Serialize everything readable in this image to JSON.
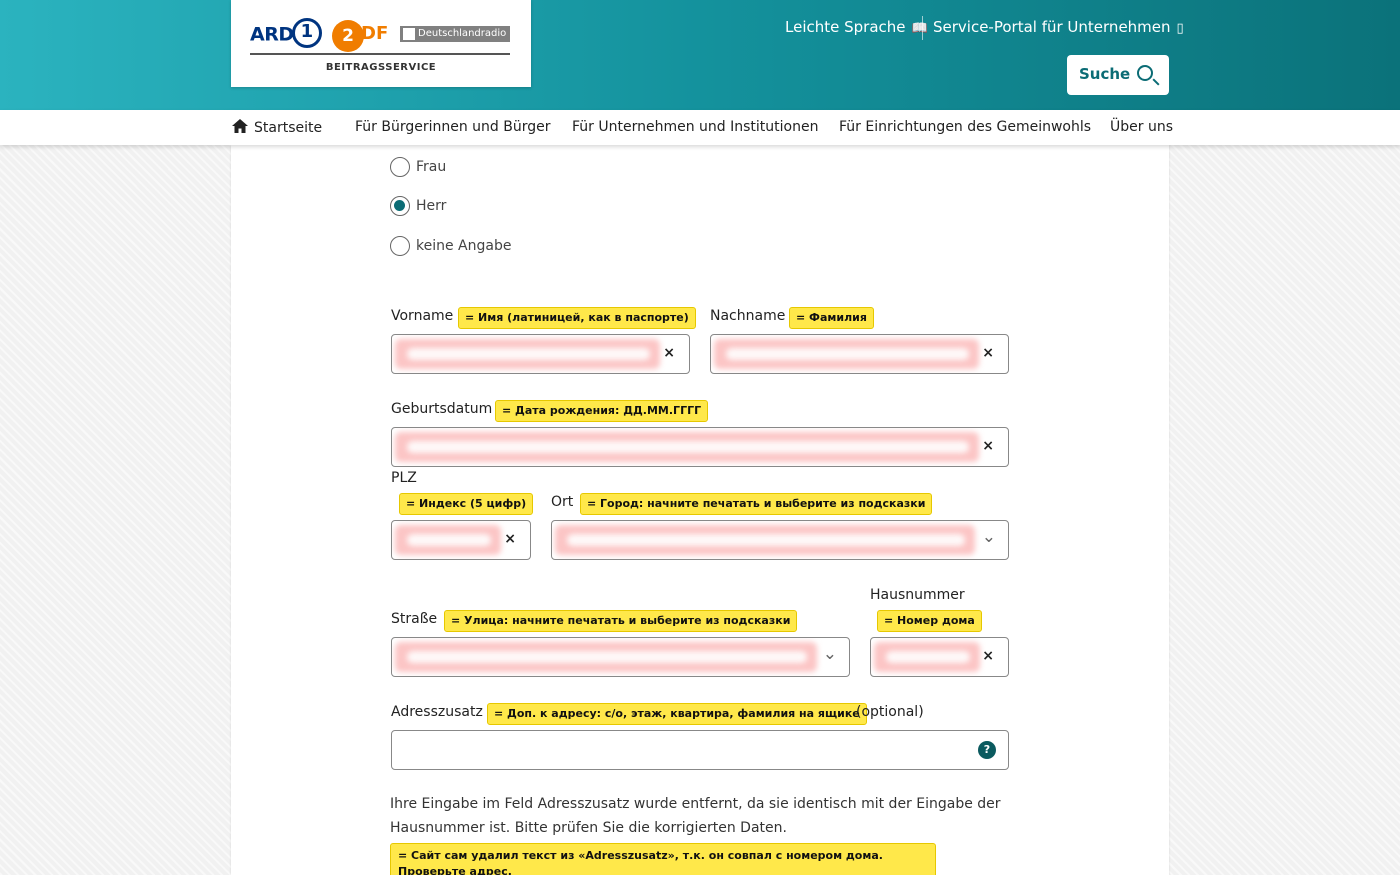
{
  "header": {
    "logos": {
      "ard": "ARD",
      "ard_one": "1",
      "zdf": "2",
      "zdf_rest": "DF",
      "dlr": "Deutschlandradio",
      "sub": "BEITRAGSSERVICE"
    },
    "links": {
      "easy_language": "Leichte Sprache",
      "service_portal": "Service-Portal für Unternehmen"
    },
    "search_label": "Suche"
  },
  "nav": {
    "items": [
      "Startseite",
      "Für Bürgerinnen und Bürger",
      "Für Unternehmen und Institutionen",
      "Für Einrichtungen des Gemeinwohls",
      "Über uns"
    ]
  },
  "form": {
    "salutation": {
      "options": [
        "Frau",
        "Herr",
        "keine Angabe"
      ],
      "selected": "Herr"
    },
    "vorname": {
      "label": "Vorname",
      "note": "= Имя (латиницей, как в паспорте)"
    },
    "nachname": {
      "label": "Nachname",
      "note": "= Фамилия"
    },
    "geburtsdatum": {
      "label": "Geburtsdatum",
      "note": "= Дата рождения: ДД.ММ.ГГГГ"
    },
    "plz": {
      "label": "PLZ",
      "note": "= Индекс (5 цифр)"
    },
    "ort": {
      "label": "Ort",
      "note": "= Город: начните печатать и выберите из подсказки"
    },
    "strasse": {
      "label": "Straße",
      "note": "= Улица: начните печатать и выберите из подсказки"
    },
    "hausnummer": {
      "label": "Hausnummer",
      "note": "= Номер дома"
    },
    "adresszusatz": {
      "label": "Adresszusatz",
      "note": "= Доп. к адресу: c/o, этаж, квартира, фамилия на ящике",
      "optional": "(optional)",
      "value": ""
    },
    "clear_symbol": "×",
    "help_symbol": "?",
    "info_text": "Ihre Eingabe im Feld Adresszusatz wurde entfernt, da sie identisch mit der Eingabe der Haus­nummer ist. Bitte prüfen Sie die korrigierten Daten.",
    "info_note": "= Сайт сам удалил текст из «Adresszusatz», т.к. он совпал с номером дома. Проверьте адрес."
  }
}
